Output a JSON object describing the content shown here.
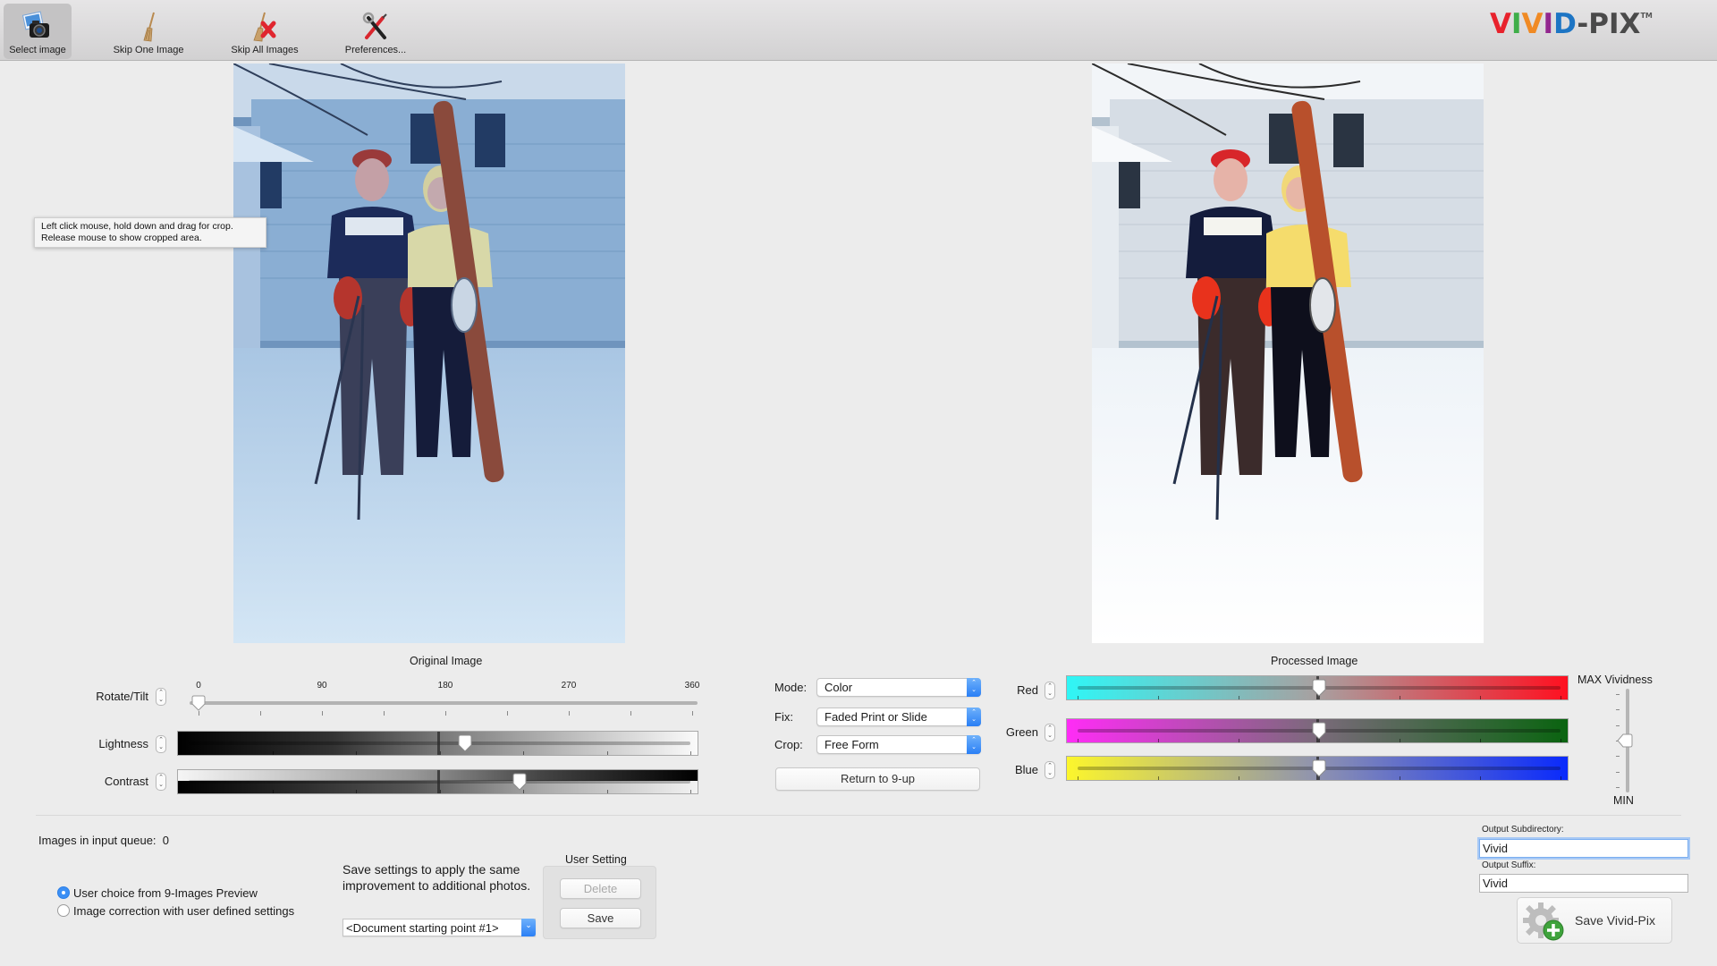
{
  "toolbar": {
    "items": [
      {
        "label": "Select image",
        "icon": "camera-photos-icon",
        "active": true
      },
      {
        "label": "Skip One Image",
        "icon": "broom-icon",
        "active": false
      },
      {
        "label": "Skip All Images",
        "icon": "broom-x-icon",
        "active": false
      },
      {
        "label": "Preferences...",
        "icon": "tools-icon",
        "active": false
      }
    ],
    "logo": {
      "letters": [
        {
          "ch": "V",
          "color": "#e8222c"
        },
        {
          "ch": "I",
          "color": "#3fae49"
        },
        {
          "ch": "V",
          "color": "#f08a24"
        },
        {
          "ch": "I",
          "color": "#93278f"
        },
        {
          "ch": "D",
          "color": "#1d75c4"
        },
        {
          "ch": "-PIX",
          "color": "#4a4a4a"
        }
      ],
      "trademark": "TM"
    }
  },
  "tooltip": {
    "line1": "Left click mouse, hold down and drag for crop.",
    "line2": "Release mouse to show cropped area."
  },
  "original": {
    "label": "Original Image",
    "rotate": {
      "label": "Rotate/Tilt",
      "ticks": [
        "0",
        "90",
        "180",
        "270",
        "360"
      ],
      "value_deg": 0,
      "min": 0,
      "max": 360
    },
    "lightness": {
      "label": "Lightness",
      "value_fraction": 0.55
    },
    "contrast": {
      "label": "Contrast",
      "value_fraction": 0.66
    }
  },
  "settings": {
    "mode": {
      "label": "Mode:",
      "value": "Color"
    },
    "fix": {
      "label": "Fix:",
      "value": "Faded Print or Slide"
    },
    "crop": {
      "label": "Crop:",
      "value": "Free Form"
    },
    "return_button": "Return to 9-up"
  },
  "processed": {
    "label": "Processed Image",
    "red": {
      "label": "Red",
      "value_fraction": 0.5,
      "from": "#2ff6f6",
      "to": "#ff1020"
    },
    "green": {
      "label": "Green",
      "value_fraction": 0.5,
      "from": "#ff2cf6",
      "to": "#0a6410"
    },
    "blue": {
      "label": "Blue",
      "value_fraction": 0.5,
      "from": "#fcf62c",
      "to": "#0a2afc"
    },
    "vividness": {
      "max_label": "MAX Vividness",
      "min_label": "MIN",
      "value_fraction": 0.5
    }
  },
  "queue": {
    "label": "Images in input queue:",
    "count": "0"
  },
  "mode_choice": {
    "options": [
      {
        "label": "User choice from 9-Images Preview",
        "selected": true
      },
      {
        "label": "Image correction with user defined settings",
        "selected": false
      }
    ]
  },
  "user_settings": {
    "hint_line1": "Save settings to apply the same",
    "hint_line2": "improvement to additional photos.",
    "group_label": "User Setting",
    "preset_value": "<Document starting point #1>",
    "delete_button": "Delete",
    "save_button": "Save"
  },
  "output": {
    "subdir_label": "Output Subdirectory:",
    "subdir_value": "Vivid",
    "suffix_label": "Output Suffix:",
    "suffix_value": "Vivid",
    "save_button": "Save Vivid-Pix"
  }
}
